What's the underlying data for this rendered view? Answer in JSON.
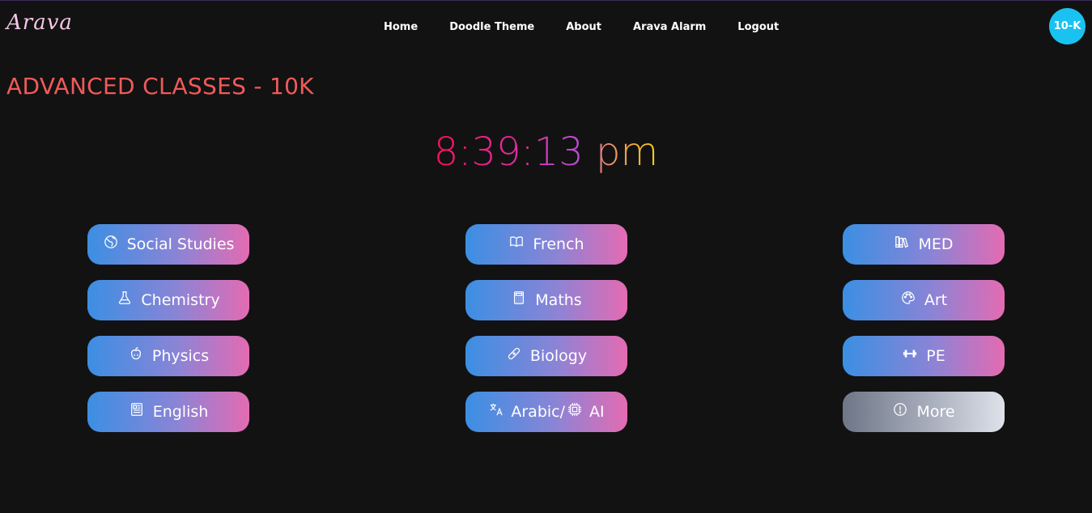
{
  "nav": {
    "logo": "Arava",
    "links": [
      "Home",
      "Doodle Theme",
      "About",
      "Arava Alarm",
      "Logout"
    ],
    "avatar": "10-K"
  },
  "page": {
    "title": "ADVANCED CLASSES - 10K"
  },
  "clock": {
    "time": "8:39:13",
    "ampm": "pm"
  },
  "subjects": [
    {
      "label": "Social Studies",
      "icon": "globe-icon"
    },
    {
      "label": "French",
      "icon": "book-icon"
    },
    {
      "label": "MED",
      "icon": "books-icon"
    },
    {
      "label": "Chemistry",
      "icon": "flask-icon"
    },
    {
      "label": "Maths",
      "icon": "calculator-icon"
    },
    {
      "label": "Art",
      "icon": "palette-icon"
    },
    {
      "label": "Physics",
      "icon": "apple-icon"
    },
    {
      "label": "Biology",
      "icon": "bandage-icon"
    },
    {
      "label": "PE",
      "icon": "dumbbell-icon"
    },
    {
      "label": "English",
      "icon": "newspaper-icon"
    },
    {
      "label": "Arabic/",
      "label2": "AI",
      "icon": "translate-icon",
      "icon2": "cpu-icon"
    },
    {
      "label": "More",
      "icon": "info-icon"
    }
  ],
  "colors": {
    "background": "#121212",
    "title": "#f05a5a",
    "avatar": "#19c2f0",
    "button_start": "#3b8fe3",
    "button_end": "#e46bb2"
  }
}
